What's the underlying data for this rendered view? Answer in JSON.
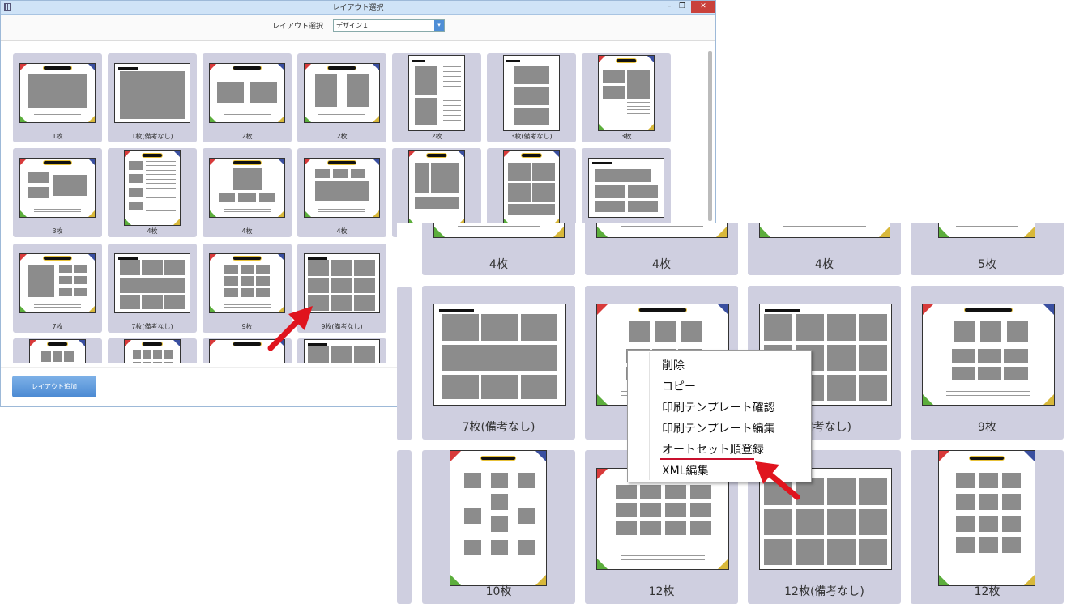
{
  "window": {
    "title": "レイアウト選択",
    "min_glyph": "–",
    "max_glyph": "❐",
    "close_glyph": "✕"
  },
  "toolbar": {
    "layout_label": "レイアウト選択",
    "layout_value": "デザイン１",
    "dropdown_glyph": "▾"
  },
  "grid_tiles": [
    {
      "label": "1枚"
    },
    {
      "label": "1枚(備考なし)"
    },
    {
      "label": "2枚"
    },
    {
      "label": "2枚"
    },
    {
      "label": "2枚"
    },
    {
      "label": "3枚(備考なし)"
    },
    {
      "label": "3枚"
    },
    {
      "label": "3枚"
    },
    {
      "label": "4枚"
    },
    {
      "label": "4枚"
    },
    {
      "label": "4枚"
    },
    {
      "label": ""
    },
    {
      "label": ""
    },
    {
      "label": ""
    },
    {
      "label": "7枚"
    },
    {
      "label": "7枚(備考なし)"
    },
    {
      "label": "9枚"
    },
    {
      "label": "9枚(備考なし)"
    }
  ],
  "add_button": "レイアウト追加",
  "zoom_tiles": [
    {
      "label": "4枚"
    },
    {
      "label": "4枚"
    },
    {
      "label": "4枚"
    },
    {
      "label": "5枚"
    },
    {
      "label": "7枚(備考なし)"
    },
    {
      "label": ""
    },
    {
      "label": "(備考なし)"
    },
    {
      "label": "9枚"
    },
    {
      "label": "10枚"
    },
    {
      "label": "12枚"
    },
    {
      "label": "12枚(備考なし)"
    },
    {
      "label": "12枚"
    }
  ],
  "context_menu": [
    {
      "label": "削除"
    },
    {
      "label": "コピー"
    },
    {
      "label": "印刷テンプレート確認"
    },
    {
      "label": "印刷テンプレート編集"
    },
    {
      "label": "オートセット順登録"
    },
    {
      "label": "XML編集"
    }
  ],
  "colors": {
    "tile_bg": "#cfcfe0",
    "accent_blue": "#4a89d2",
    "arrow_red": "#e0141e",
    "corner_red": "#d83a3a",
    "corner_blue": "#3a4fa0",
    "corner_green": "#5cae3c",
    "corner_yellow": "#d8b83a"
  }
}
